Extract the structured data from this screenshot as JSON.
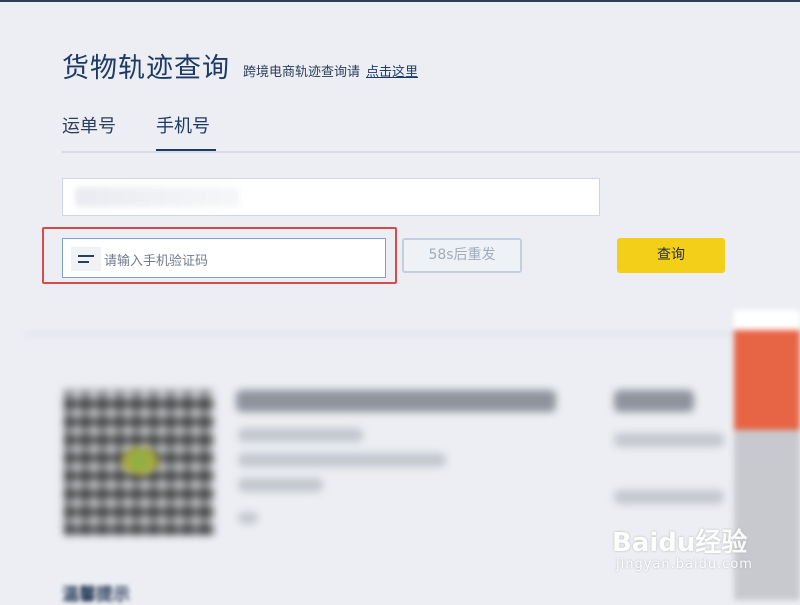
{
  "header": {
    "title": "货物轨迹查询",
    "subtitle": "跨境电商轨迹查询请",
    "subtitle_link": "点击这里"
  },
  "tabs": [
    {
      "label": "运单号",
      "active": false
    },
    {
      "label": "手机号",
      "active": true
    }
  ],
  "form": {
    "code_placeholder": "请输入手机验证码",
    "resend_label": "58s后重发",
    "query_label": "查询"
  },
  "watermark": {
    "brand": "Baidu经验",
    "url": "jingyan.baidu.com"
  },
  "footer": {
    "partial_text": "温馨提示"
  },
  "colors": {
    "accent": "#1d3a66",
    "query_button": "#f4cf1a",
    "highlight_box": "#d94a4a"
  }
}
